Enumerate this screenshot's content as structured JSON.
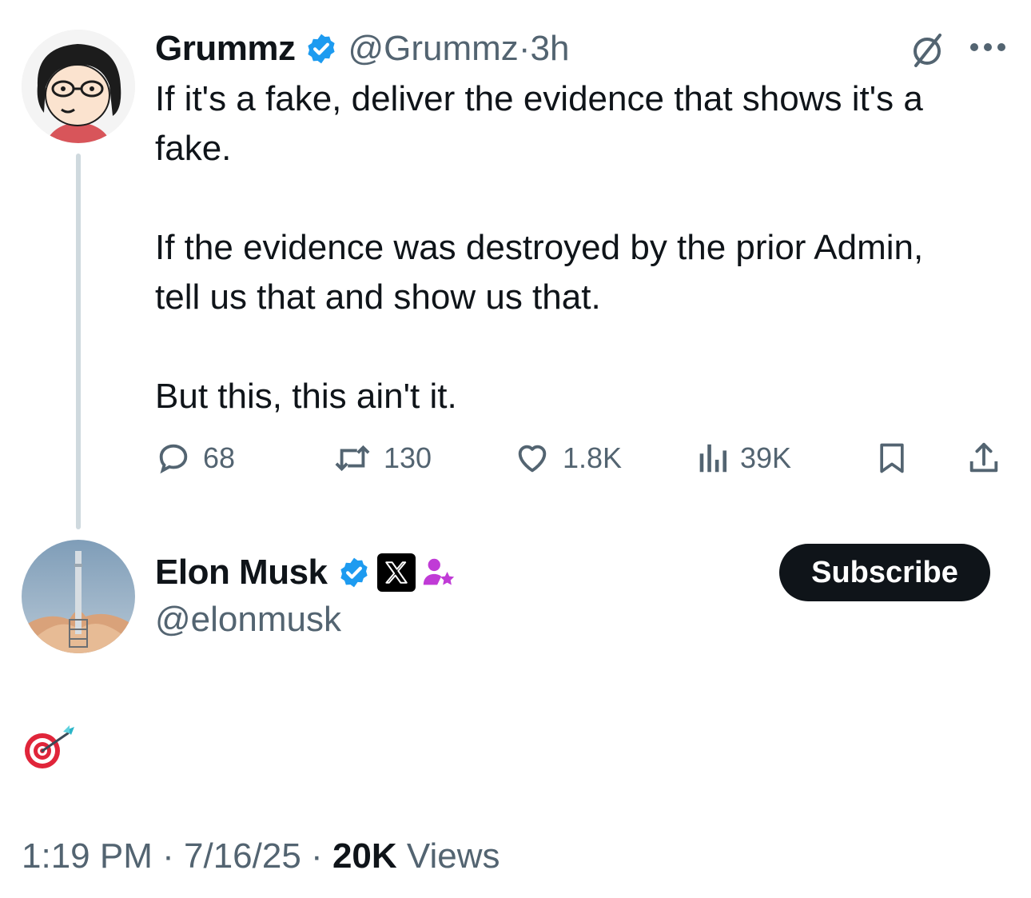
{
  "parent_tweet": {
    "author_name": "Grummz",
    "handle": "@Grummz",
    "separator": "·",
    "time_ago": "3h",
    "lines": [
      "If it's a fake, deliver the evidence that shows it's a",
      "fake.",
      "If the evidence was destroyed by the prior Admin,",
      "tell us that and show us that.",
      "But this, this ain't it."
    ],
    "stats": {
      "replies": "68",
      "reposts": "130",
      "likes": "1.8K",
      "views": "39K"
    }
  },
  "reply": {
    "author_name": "Elon Musk",
    "handle": "@elonmusk",
    "subscribe_label": "Subscribe",
    "content_emoji": "direct-hit-emoji",
    "timestamp_time": "1:19 PM",
    "timestamp_sep": "·",
    "timestamp_date": "7/16/25",
    "views_count": "20K",
    "views_label": "Views"
  },
  "colors": {
    "verified": "#1d9bf0",
    "muted_text": "#536471",
    "thread_line": "#cfd9de",
    "subscribe_bg": "#0f1419",
    "affiliate_purple": "#c03bd6"
  }
}
